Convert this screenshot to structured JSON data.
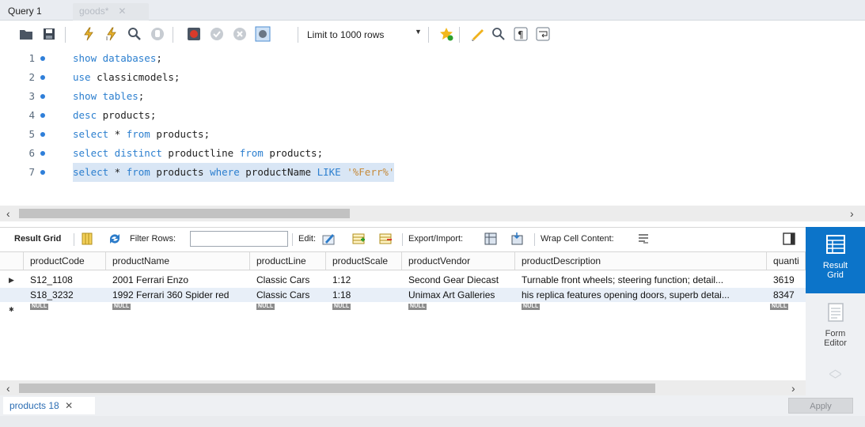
{
  "tabs": [
    {
      "label": "Query 1"
    },
    {
      "label": "goods*"
    }
  ],
  "toolbar": {
    "limit_label": "Limit to 1000 rows"
  },
  "editor": {
    "lines": [
      {
        "num": "1",
        "text": "show databases;"
      },
      {
        "num": "2",
        "text": "use classicmodels;"
      },
      {
        "num": "3",
        "text": "show tables;"
      },
      {
        "num": "4",
        "text": "desc products;"
      },
      {
        "num": "5",
        "text": "select * from products;"
      },
      {
        "num": "6",
        "text": "select distinct productline from products;"
      },
      {
        "num": "7",
        "text": "select * from products where productName LIKE '%Ferr%'"
      }
    ]
  },
  "results_toolbar": {
    "result_grid": "Result Grid",
    "filter_rows": "Filter Rows:",
    "edit": "Edit:",
    "export_import": "Export/Import:",
    "wrap_cell": "Wrap Cell Content:"
  },
  "grid": {
    "columns": [
      "productCode",
      "productName",
      "productLine",
      "productScale",
      "productVendor",
      "productDescription",
      "quanti"
    ],
    "rows": [
      [
        "S12_1108",
        "2001 Ferrari Enzo",
        "Classic Cars",
        "1:12",
        "Second Gear Diecast",
        "Turnable front wheels; steering function; detail...",
        "3619"
      ],
      [
        "S18_3232",
        "1992 Ferrari 360 Spider red",
        "Classic Cars",
        "1:18",
        "Unimax Art Galleries",
        "his replica features opening doors, superb detai...",
        "8347"
      ]
    ],
    "null_label": "NULL"
  },
  "side_panel": {
    "result_grid_label_1": "Result",
    "result_grid_label_2": "Grid",
    "form_editor_label_1": "Form",
    "form_editor_label_2": "Editor"
  },
  "bottom": {
    "output_tab": "products 18",
    "apply": "Apply"
  }
}
